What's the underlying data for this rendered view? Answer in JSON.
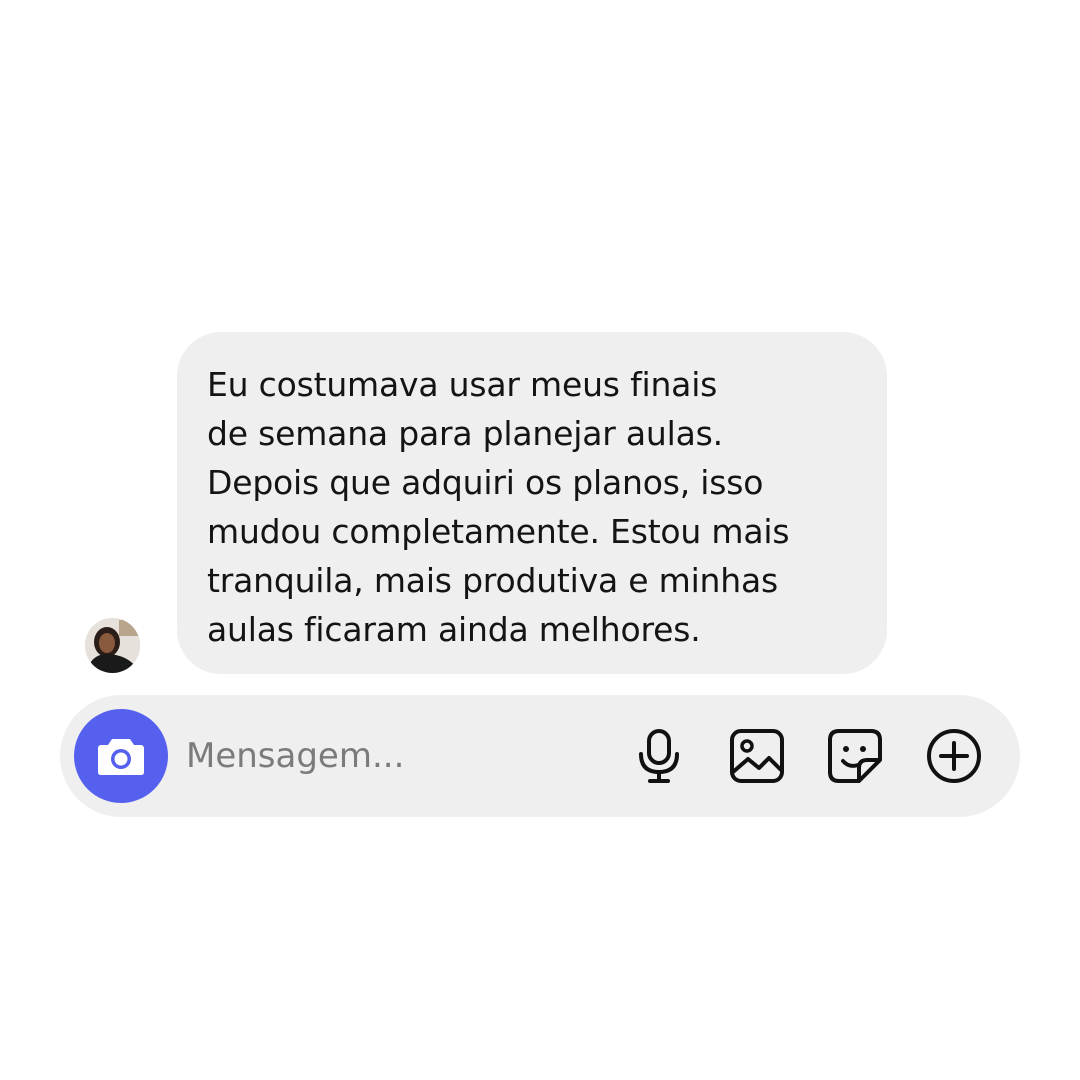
{
  "message": {
    "text": "Eu costumava usar meus finais\nde semana para planejar aulas.\nDepois que adquiri os planos, isso\nmudou completamente. Estou mais\ntranquila, mais produtiva e minhas\naulas ficaram ainda melhores."
  },
  "composer": {
    "placeholder": "Mensagem...",
    "camera_icon": "camera-icon",
    "mic_icon": "microphone-icon",
    "gallery_icon": "image-gallery-icon",
    "sticker_icon": "sticker-icon",
    "plus_icon": "plus-circle-icon"
  },
  "colors": {
    "bubble": "#efefef",
    "composer": "#efefef",
    "camera_button": "#5561ee",
    "text": "#141414",
    "placeholder": "#7b7b7b"
  }
}
